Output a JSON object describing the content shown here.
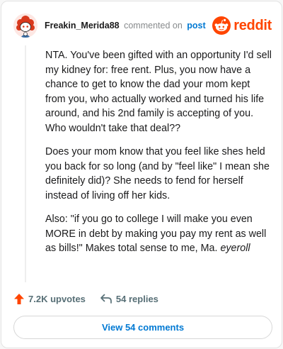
{
  "comment": {
    "author": "Freakin_Merida88",
    "verb": "commented on",
    "target": "post",
    "paragraphs": [
      "NTA. You've been gifted with an opportunity I'd sell my kidney for: free rent. Plus, you now have a chance to get to know the dad your mom kept from you, who actually worked and turned his life around, and his 2nd family is accepting of you. Who wouldn't take that deal??",
      "Does your mom know that you feel like shes held you back for so long (and by \"feel like\" I mean she definitely did)? She needs to fend for herself instead of living off her kids."
    ],
    "last_paragraph_text": "Also: \"if you go to college I will make you even MORE in debt by making you pay my rent as well as bills!\" Makes total sense to me, Ma. ",
    "last_paragraph_emphasis": "eyeroll"
  },
  "brand": {
    "name": "reddit",
    "icon": "reddit-logo-icon",
    "color": "#ff4500"
  },
  "actions": {
    "upvotes": "7.2K upvotes",
    "replies": "54 replies",
    "view_comments": "View 54 comments"
  },
  "colors": {
    "accent": "#ff4500",
    "link": "#0079d3",
    "muted": "#576f76"
  }
}
